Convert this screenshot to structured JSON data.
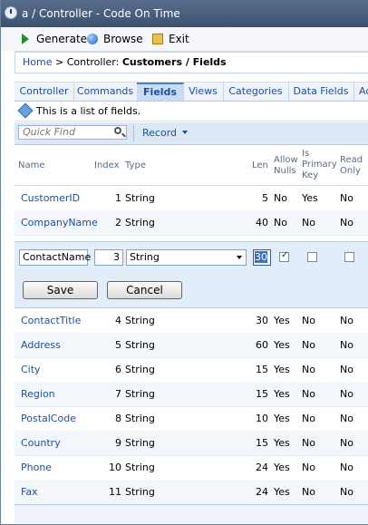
{
  "window": {
    "title": "a / Controller - Code On Time"
  },
  "toolbar": {
    "generate": "Generate",
    "browse": "Browse",
    "exit": "Exit"
  },
  "breadcrumb": {
    "home": "Home",
    "sep": " > ",
    "prefix": "Controller: ",
    "current": "Customers / Fields"
  },
  "tabs": [
    "Controller",
    "Commands",
    "Fields",
    "Views",
    "Categories",
    "Data Fields",
    "Ac"
  ],
  "active_tab": "Fields",
  "description": "This is a list of fields.",
  "quick_find": {
    "placeholder": "Quick Find"
  },
  "record_menu": "Record",
  "columns": {
    "name": "Name",
    "index": "Index",
    "type": "Type",
    "len": "Len",
    "allow_nulls": [
      "Allow",
      "Nulls"
    ],
    "primary_key": [
      "Is",
      "Primary",
      "Key"
    ],
    "read_only": [
      "Read",
      "Only"
    ]
  },
  "rows_top": [
    {
      "name": "CustomerID",
      "index": "1",
      "type": "String",
      "len": "5",
      "nulls": "No",
      "pk": "Yes",
      "ro": "No"
    },
    {
      "name": "CompanyName",
      "index": "2",
      "type": "String",
      "len": "40",
      "nulls": "No",
      "pk": "No",
      "ro": "No"
    }
  ],
  "edit_row": {
    "name": "ContactName",
    "index": "3",
    "type": "String",
    "len": "30",
    "allow_nulls": true,
    "primary_key": false,
    "read_only": false,
    "save": "Save",
    "cancel": "Cancel"
  },
  "rows_bottom": [
    {
      "name": "ContactTitle",
      "index": "4",
      "type": "String",
      "len": "30",
      "nulls": "Yes",
      "pk": "No",
      "ro": "No"
    },
    {
      "name": "Address",
      "index": "5",
      "type": "String",
      "len": "60",
      "nulls": "Yes",
      "pk": "No",
      "ro": "No"
    },
    {
      "name": "City",
      "index": "6",
      "type": "String",
      "len": "15",
      "nulls": "Yes",
      "pk": "No",
      "ro": "No"
    },
    {
      "name": "Region",
      "index": "7",
      "type": "String",
      "len": "15",
      "nulls": "Yes",
      "pk": "No",
      "ro": "No"
    },
    {
      "name": "PostalCode",
      "index": "8",
      "type": "String",
      "len": "10",
      "nulls": "Yes",
      "pk": "No",
      "ro": "No"
    },
    {
      "name": "Country",
      "index": "9",
      "type": "String",
      "len": "15",
      "nulls": "Yes",
      "pk": "No",
      "ro": "No"
    },
    {
      "name": "Phone",
      "index": "10",
      "type": "String",
      "len": "24",
      "nulls": "Yes",
      "pk": "No",
      "ro": "No"
    },
    {
      "name": "Fax",
      "index": "11",
      "type": "String",
      "len": "24",
      "nulls": "Yes",
      "pk": "No",
      "ro": "No"
    }
  ]
}
